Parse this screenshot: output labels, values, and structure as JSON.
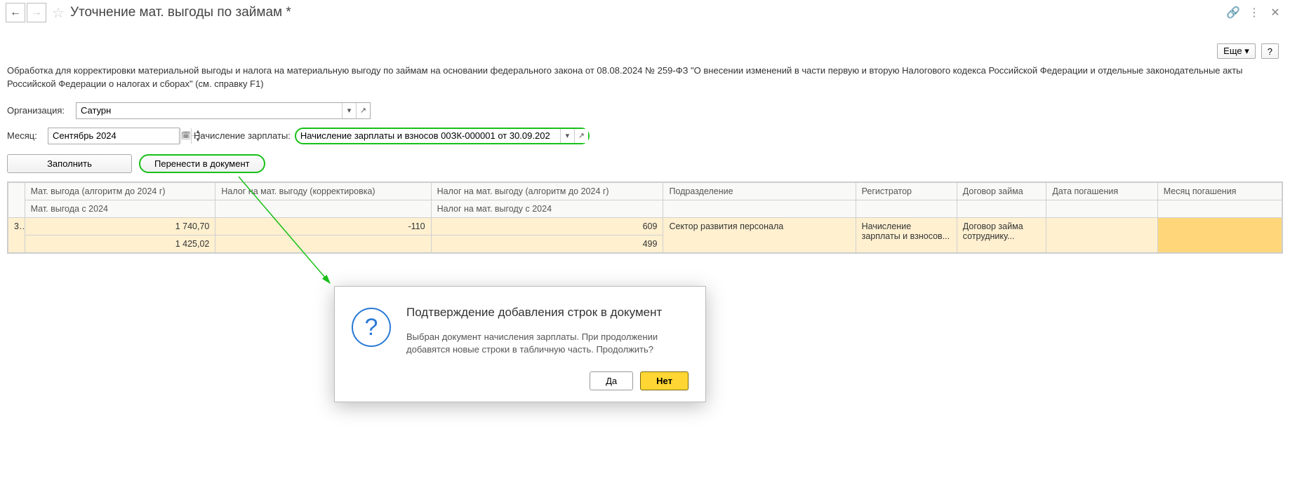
{
  "header": {
    "title": "Уточнение мат. выгоды по займам *"
  },
  "top_actions": {
    "more": "Еще",
    "help": "?"
  },
  "description": "Обработка для корректировки материальной выгоды и налога на материальную выгоду по займам на основании федерального закона от 08.08.2024 № 259-ФЗ \"О внесении изменений в части первую и вторую Налогового кодекса Российской Федерации и отдельные законодательные акты Российской Федерации о налогах и сборах\" (см. справку F1)",
  "form": {
    "org_label": "Организация:",
    "org_value": "Сатурн",
    "month_label": "Месяц:",
    "month_value": "Сентябрь 2024",
    "calc_label": "Начисление зарплаты:",
    "calc_value": "Начисление зарплаты и взносов 00ЗК-000001 от 30.09.202"
  },
  "toolbar": {
    "fill": "Заполнить",
    "transfer": "Перенести в документ"
  },
  "table": {
    "headers": {
      "r1": [
        "Мат. выгода (алгоритм до 2024 г)",
        "Налог на мат. выгоду (корректировка)",
        "Налог на мат. выгоду (алгоритм до 2024 г)",
        "Подразделение",
        "Регистратор",
        "Договор займа",
        "Дата погашения",
        "Месяц погашения"
      ],
      "r2": [
        "Мат. выгода с 2024",
        "",
        "Налог на мат. выгоду с 2024",
        "",
        "",
        "",
        "",
        ""
      ]
    },
    "row": {
      "n": "3",
      "r1": [
        "1 740,70",
        "-110",
        "609",
        "Сектор развития персонала",
        "Начисление зарплаты и взносов...",
        "Договор займа сотруднику...",
        "",
        ""
      ],
      "r2": [
        "1 425,02",
        "",
        "499",
        "",
        "",
        "",
        "",
        ""
      ]
    }
  },
  "dialog": {
    "title": "Подтверждение добавления строк в документ",
    "text": "Выбран документ начисления зарплаты. При продолжении добавятся новые строки в табличную часть. Продолжить?",
    "yes": "Да",
    "no": "Нет"
  }
}
